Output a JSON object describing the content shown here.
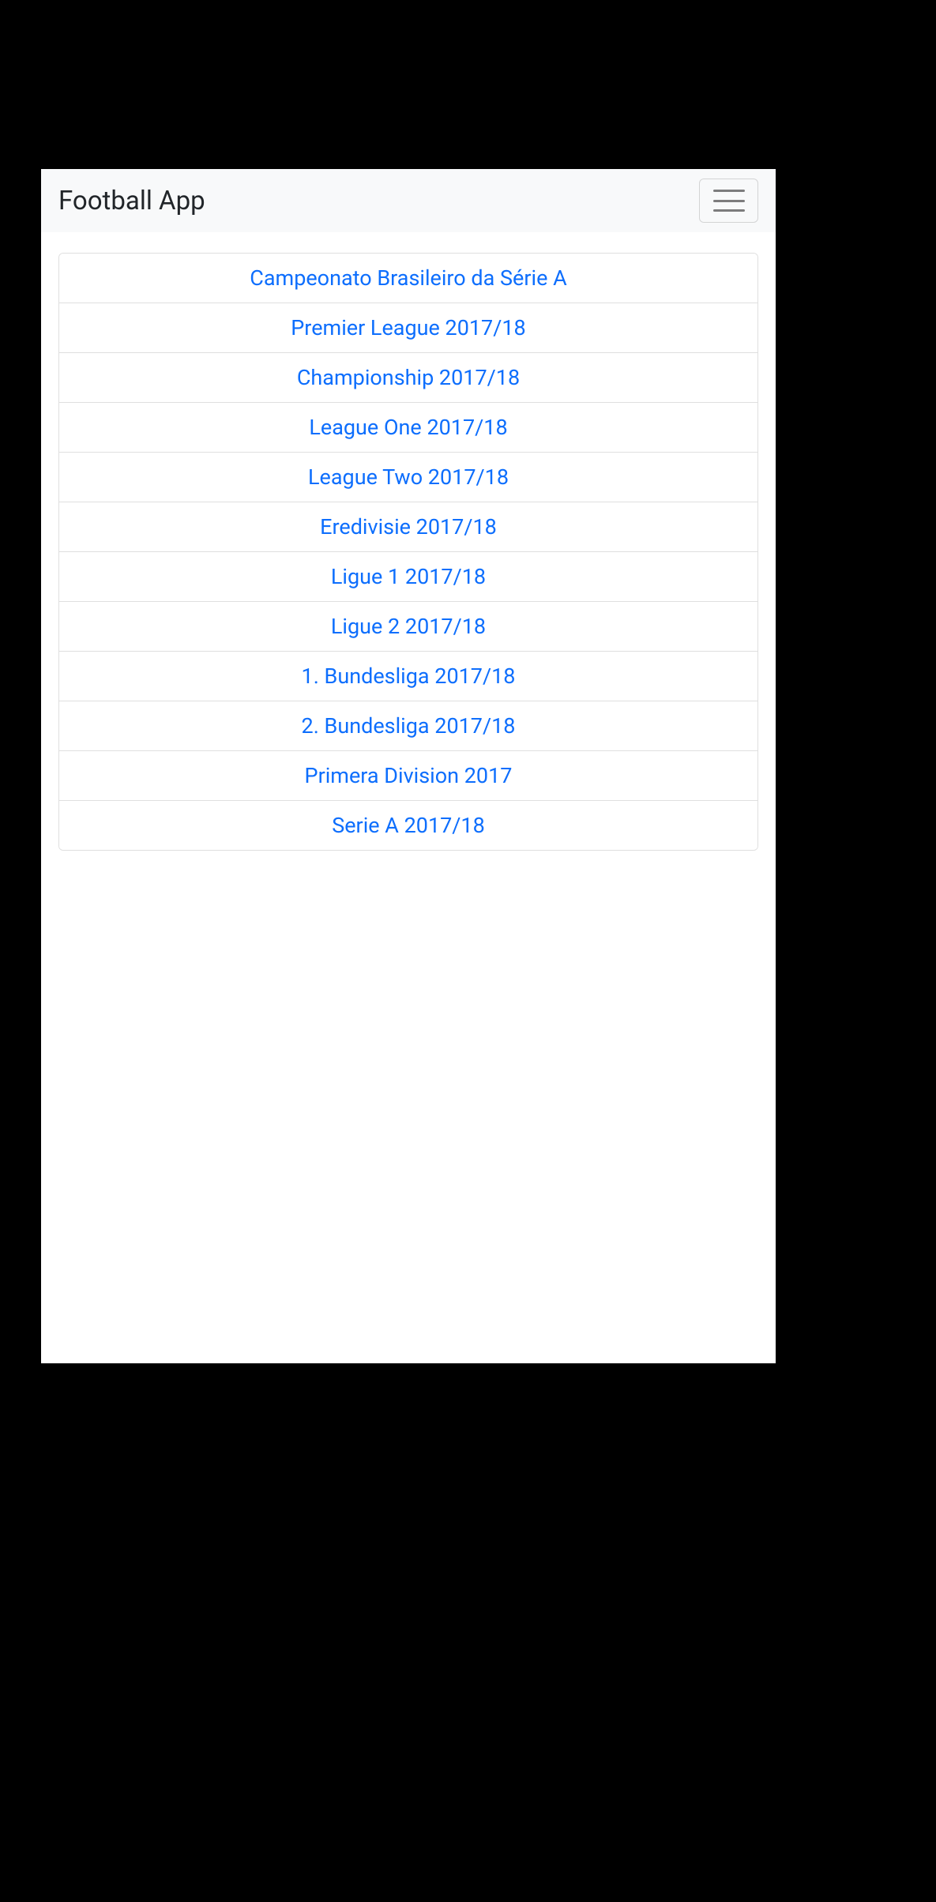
{
  "navbar": {
    "brand": "Football App"
  },
  "leagues": [
    "Campeonato Brasileiro da Série A",
    "Premier League 2017/18",
    "Championship 2017/18",
    "League One 2017/18",
    "League Two 2017/18",
    "Eredivisie 2017/18",
    "Ligue 1 2017/18",
    "Ligue 2 2017/18",
    "1. Bundesliga 2017/18",
    "2. Bundesliga 2017/18",
    "Primera Division 2017",
    "Serie A 2017/18"
  ]
}
